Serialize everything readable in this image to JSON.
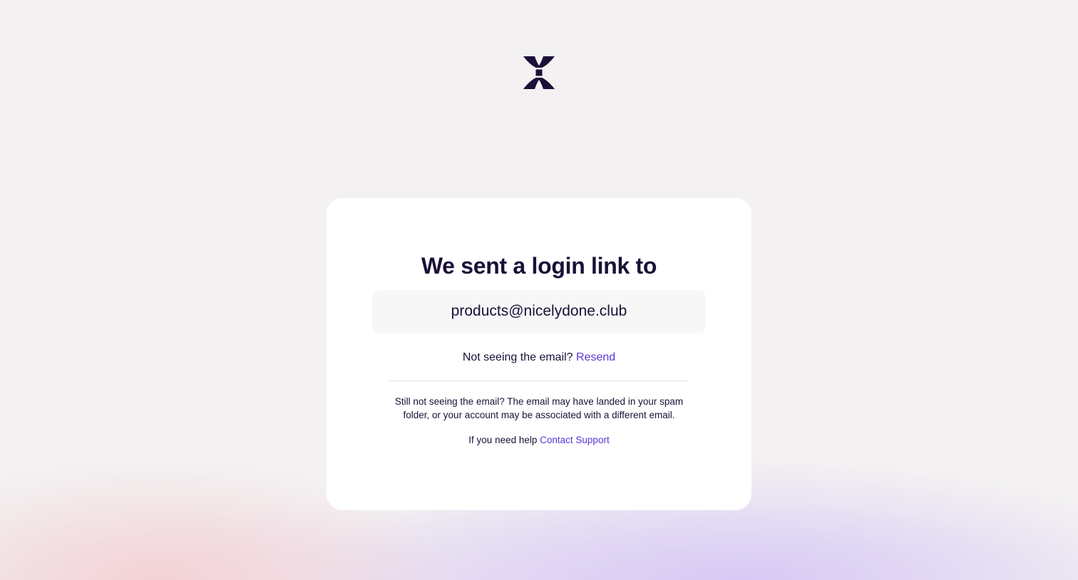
{
  "brand": {
    "logo_icon": "brand-x-logo",
    "logo_color": "#1a1038"
  },
  "card": {
    "title": "We sent a login link to",
    "email": "products@nicelydone.club",
    "resend_prompt": "Not seeing the email?",
    "resend_link": "Resend",
    "help_text": "Still not seeing the email? The email may have landed in your spam folder, or your account may be associated with a different email.",
    "support_prompt": "If you need help",
    "support_link": "Contact Support"
  },
  "colors": {
    "text": "#1a1038",
    "link": "#5b34d6",
    "background": "#f3f1f2",
    "card": "#ffffff"
  }
}
